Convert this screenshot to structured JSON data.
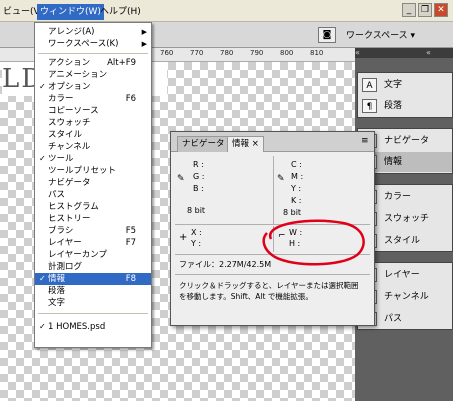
{
  "menubar": {
    "items": [
      {
        "label": "ビュー(V)"
      },
      {
        "label": "ウィンドウ(W)"
      },
      {
        "label": "ヘルプ(H)"
      }
    ]
  },
  "toolbar": {
    "workspace_label": "ワークスペース ▾"
  },
  "ruler": {
    "ticks": [
      "760",
      "770",
      "780",
      "790",
      "800",
      "810"
    ]
  },
  "document": {
    "big_text": "LDI  ..."
  },
  "window_menu": {
    "items": [
      {
        "label": "アレンジ(A)",
        "shortcut": "",
        "check": "",
        "arrow": "▶"
      },
      {
        "label": "ワークスペース(K)",
        "shortcut": "",
        "check": "",
        "arrow": "▶"
      },
      {
        "label": "アクション",
        "shortcut": "Alt+F9",
        "check": "",
        "arrow": ""
      },
      {
        "label": "アニメーション",
        "shortcut": "",
        "check": "",
        "arrow": ""
      },
      {
        "label": "オプション",
        "shortcut": "",
        "check": "✓",
        "arrow": ""
      },
      {
        "label": "カラー",
        "shortcut": "F6",
        "check": "",
        "arrow": ""
      },
      {
        "label": "コピーソース",
        "shortcut": "",
        "check": "",
        "arrow": ""
      },
      {
        "label": "スウォッチ",
        "shortcut": "",
        "check": "",
        "arrow": ""
      },
      {
        "label": "スタイル",
        "shortcut": "",
        "check": "",
        "arrow": ""
      },
      {
        "label": "チャンネル",
        "shortcut": "",
        "check": "",
        "arrow": ""
      },
      {
        "label": "ツール",
        "shortcut": "",
        "check": "✓",
        "arrow": ""
      },
      {
        "label": "ツールプリセット",
        "shortcut": "",
        "check": "",
        "arrow": ""
      },
      {
        "label": "ナビゲータ",
        "shortcut": "",
        "check": "",
        "arrow": ""
      },
      {
        "label": "パス",
        "shortcut": "",
        "check": "",
        "arrow": ""
      },
      {
        "label": "ヒストグラム",
        "shortcut": "",
        "check": "",
        "arrow": ""
      },
      {
        "label": "ヒストリー",
        "shortcut": "",
        "check": "",
        "arrow": ""
      },
      {
        "label": "ブラシ",
        "shortcut": "F5",
        "check": "",
        "arrow": ""
      },
      {
        "label": "レイヤー",
        "shortcut": "F7",
        "check": "",
        "arrow": ""
      },
      {
        "label": "レイヤーカンプ",
        "shortcut": "",
        "check": "",
        "arrow": ""
      },
      {
        "label": "計測ログ",
        "shortcut": "",
        "check": "",
        "arrow": ""
      },
      {
        "label": "情報",
        "shortcut": "F8",
        "check": "✓",
        "arrow": ""
      },
      {
        "label": "段落",
        "shortcut": "",
        "check": "",
        "arrow": ""
      },
      {
        "label": "文字",
        "shortcut": "",
        "check": "",
        "arrow": ""
      },
      {
        "label": "1 HOMES.psd",
        "shortcut": "",
        "check": "✓",
        "arrow": ""
      }
    ]
  },
  "info_panel": {
    "tabs": [
      {
        "label": "ナビゲータ"
      },
      {
        "label": "情報 ×"
      }
    ],
    "rgb_labels": [
      "R :",
      "G :",
      "B :"
    ],
    "cmyk_labels": [
      "C :",
      "M :",
      "Y :",
      "K :"
    ],
    "bit_left": "8 bit",
    "bit_right": "8 bit",
    "xy_labels": [
      "X :",
      "Y :"
    ],
    "wh_labels": [
      "W :",
      "H :"
    ],
    "file_size": "ファイル：2.27M/42.5M",
    "hint_line1": "クリック＆ドラッグすると、レイヤーまたは選択範囲",
    "hint_line2": "を移動します。Shift、Alt で機能拡張。"
  },
  "dock": {
    "group1": [
      {
        "icon": "A",
        "label": "文字"
      },
      {
        "icon": "¶",
        "label": "段落"
      }
    ],
    "group2": [
      {
        "icon": "◈",
        "label": "ナビゲータ"
      },
      {
        "icon": "i",
        "label": "情報"
      }
    ],
    "group3": [
      {
        "icon": "▦",
        "label": "カラー"
      },
      {
        "icon": "▥",
        "label": "スウォッチ"
      },
      {
        "icon": "fx",
        "label": "スタイル"
      }
    ],
    "group4": [
      {
        "icon": "◆",
        "label": "レイヤー"
      },
      {
        "icon": "◉",
        "label": "チャンネル"
      },
      {
        "icon": "⌐",
        "label": "パス"
      }
    ]
  },
  "colors": {
    "menu_highlight": "#316ac5",
    "annotation": "#e0001a"
  }
}
